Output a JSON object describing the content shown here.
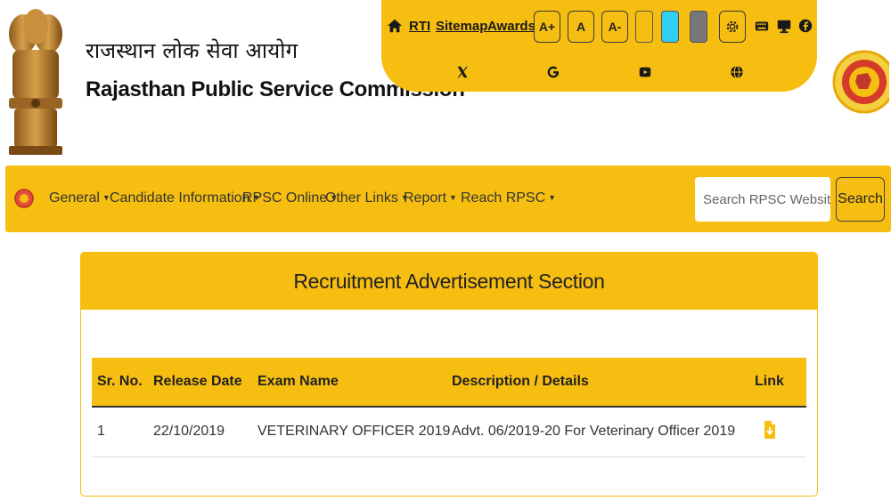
{
  "header": {
    "title_hindi": "राजस्थान लोक सेवा आयोग",
    "title_english": "Rajasthan Public Service Commission",
    "emblem_icon": "ashoka-emblem-icon",
    "seal_icon": "rpsc-seal-icon"
  },
  "toolbar": {
    "home_icon": "home-icon",
    "links": {
      "rti": "RTI",
      "sitemap": "Sitemap",
      "awards": "Awards"
    },
    "font_sizes": {
      "increase": "A+",
      "normal": "A",
      "decrease": "A-"
    },
    "themes": [
      {
        "name": "white",
        "color": "#ffffff"
      },
      {
        "name": "cyan",
        "color": "#33cdf0"
      },
      {
        "name": "grey",
        "color": "#777777"
      }
    ],
    "social_icons": [
      "settings-icon",
      "keyboard-icon",
      "desktop-icon",
      "facebook-icon",
      "x-icon",
      "google-icon",
      "youtube-icon",
      "globe-icon"
    ],
    "accent_color": "#f7be12"
  },
  "nav": {
    "items": [
      {
        "label": "General"
      },
      {
        "label": "Candidate Information"
      },
      {
        "label": "RPSC Online"
      },
      {
        "label": "Other Links"
      },
      {
        "label": "Report"
      },
      {
        "label": "Reach RPSC"
      }
    ],
    "search": {
      "placeholder": "Search RPSC Website",
      "button_label": "Search"
    }
  },
  "section": {
    "title": "Recruitment Advertisement Section",
    "columns": [
      "Sr. No.",
      "Release Date",
      "Exam Name",
      "Description / Details",
      "Link"
    ],
    "rows": [
      {
        "sr": "1",
        "release_date": "22/10/2019",
        "exam_name": "VETERINARY OFFICER 2019",
        "description": "Advt. 06/2019-20 For Veterinary Officer 2019",
        "link_icon": "pdf-download-icon"
      }
    ]
  }
}
